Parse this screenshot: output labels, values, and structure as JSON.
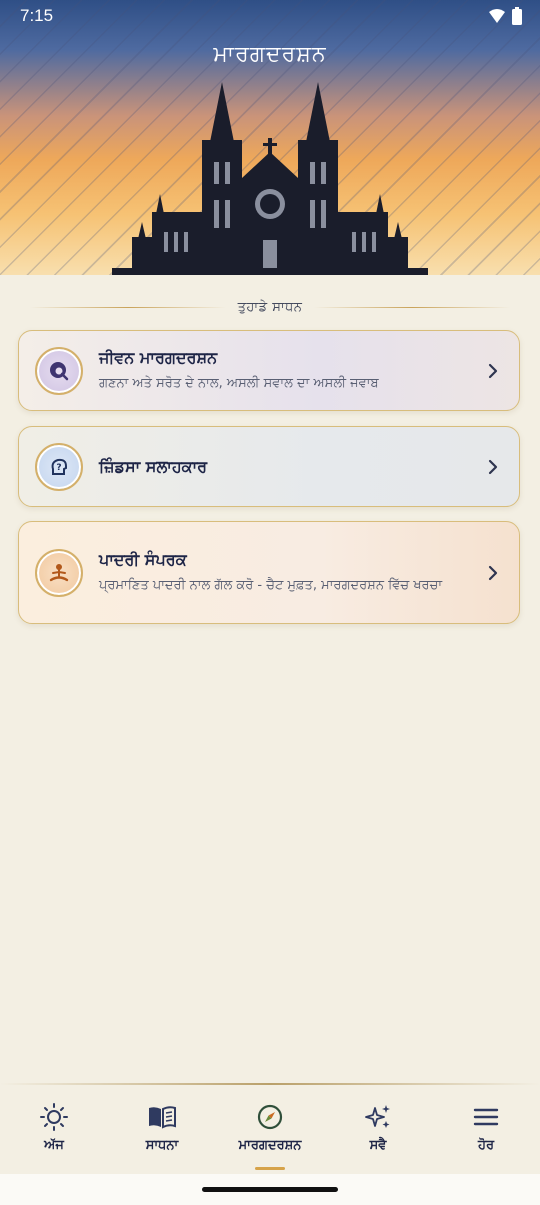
{
  "status_bar": {
    "time": "7:15"
  },
  "header": {
    "title": "ਮਾਰਗਦਰਸ਼ਨ"
  },
  "section": {
    "title": "ਤੁਹਾਡੇ ਸਾਧਨ"
  },
  "cards": [
    {
      "title": "ਜੀਵਨ ਮਾਰਗਦਰਸ਼ਨ",
      "subtitle": "ਗਣਨਾ ਅਤੇ ਸਰੋਤ ਦੇ ਨਾਲ, ਅਸਲੀ ਸਵਾਲ ਦਾ ਅਸਲੀ ਜਵਾਬ",
      "icon": "search-globe-icon"
    },
    {
      "title": "ਜ਼ਿੰਡਸਾ ਸਲਾਹਕਾਰ",
      "icon": "question-head-icon"
    },
    {
      "title": "ਪਾਦਰੀ ਸੰਪਰਕ",
      "subtitle": "ਪ੍ਰਮਾਣਿਤ ਪਾਦਰੀ ਨਾਲ ਗੱਲ ਕਰੋ - ਚੈਟ ਮੁਫ਼ਤ, ਮਾਰਗਦਰਸ਼ਨ ਵਿੱਚ ਖਰਚਾ",
      "icon": "meditation-icon"
    }
  ],
  "bottom_nav": {
    "items": [
      {
        "label": "ਅੱਜ",
        "icon": "sun-icon"
      },
      {
        "label": "ਸਾਧਨਾ",
        "icon": "book-icon"
      },
      {
        "label": "ਮਾਰਗਦਰਸ਼ਨ",
        "icon": "compass-icon",
        "active": true
      },
      {
        "label": "ਸਵੈ",
        "icon": "sparkles-icon"
      },
      {
        "label": "ਹੋਰ",
        "icon": "menu-icon"
      }
    ]
  },
  "colors": {
    "accent": "#d6a34a",
    "text_dark": "#1e2547",
    "background": "#f3efe3"
  }
}
